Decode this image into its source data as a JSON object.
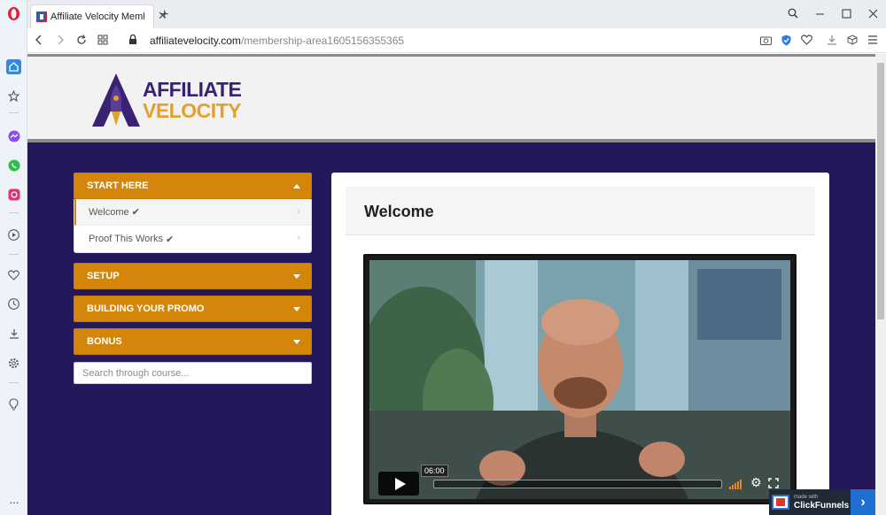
{
  "browser": {
    "tab_title": "Affiliate Velocity Members",
    "tab_close": "✕",
    "new_tab": "+",
    "url_domain": "affiliatevelocity.com",
    "url_path": "/membership-area1605156355365",
    "window_controls": [
      "search",
      "minimize",
      "maximize",
      "close"
    ]
  },
  "sidebar_icons": [
    "opera-icon",
    "home-icon",
    "bookmarks-icon",
    "messenger-icon",
    "whatsapp-icon",
    "instagram-icon",
    "player-icon",
    "heart-icon",
    "history-icon",
    "downloads-icon",
    "settings-icon",
    "lightbulb-icon",
    "more-icon"
  ],
  "site": {
    "logo_line1": "AFFILIATE",
    "logo_line2": "VELOCITY"
  },
  "course_nav": {
    "sections": [
      {
        "title": "START HERE",
        "expanded": true,
        "lessons": [
          {
            "label": "Welcome",
            "completed": true,
            "active": true
          },
          {
            "label": "Proof This Works",
            "completed": true,
            "active": false
          }
        ]
      },
      {
        "title": "SETUP",
        "expanded": false
      },
      {
        "title": "BUILDING YOUR PROMO",
        "expanded": false
      },
      {
        "title": "BONUS",
        "expanded": false
      }
    ],
    "search_placeholder": "Search through course..."
  },
  "content": {
    "title": "Welcome",
    "video": {
      "time_tooltip": "06:00",
      "colors": {
        "accent": "#e58a1c"
      }
    }
  },
  "badge": {
    "small": "made with",
    "name": "ClickFunnels",
    "arrow": "›"
  },
  "colors": {
    "brand_orange": "#d4860a",
    "page_bg": "#24175a",
    "logo_purple": "#3a2272",
    "logo_gold": "#e4a02c"
  }
}
